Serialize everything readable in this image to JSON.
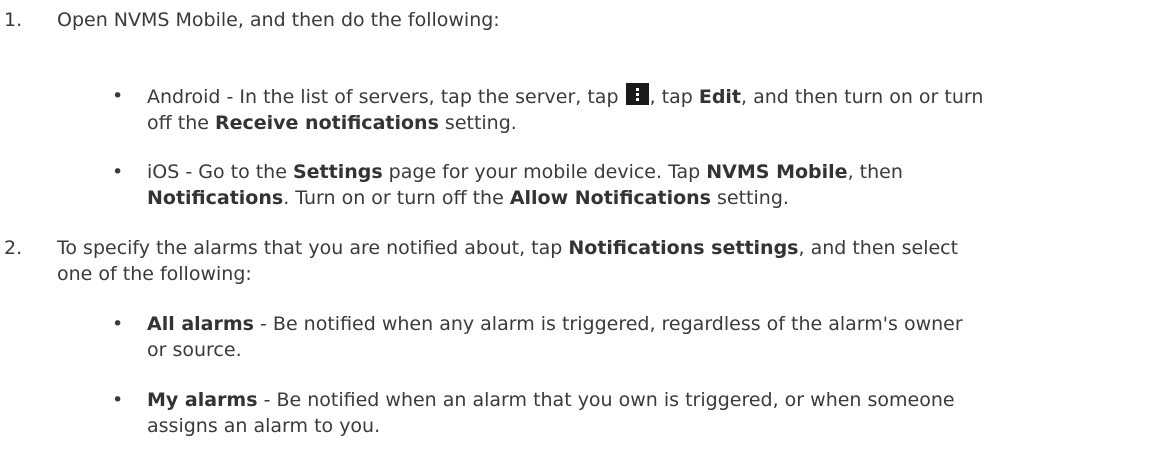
{
  "steps": [
    {
      "number": "1.",
      "text": "Open NVMS Mobile, and then do the following:",
      "bullets": [
        {
          "prefix": "Android - In the list of servers, tap the server, tap ",
          "after_icon": ", tap ",
          "bold1": "Edit",
          "mid": ", and then turn on or turn off the ",
          "bold2": "Receive notifications",
          "suffix": " setting."
        },
        {
          "prefix": "iOS - Go to the ",
          "bold1": "Settings",
          "mid1": " page for your mobile device. Tap ",
          "bold2": "NVMS Mobile",
          "mid2": ", then ",
          "bold3": "Notifications",
          "mid3": ". Turn on or turn off the ",
          "bold4": "Allow Notifications",
          "suffix": " setting."
        }
      ]
    },
    {
      "number": "2.",
      "prefix": "To specify the alarms that you are notified about, tap ",
      "bold": "Notifications settings",
      "suffix": ", and then select one of the following:",
      "bullets": [
        {
          "bold": "All alarms",
          "text": " - Be notified when any alarm is triggered, regardless of the alarm's owner or source."
        },
        {
          "bold": "My alarms",
          "text": " - Be notified when an alarm that you own is triggered, or when someone assigns an alarm to you."
        }
      ]
    }
  ],
  "bullet_glyph": "•",
  "icons": {
    "overflow_menu": "more-vertical-icon"
  }
}
